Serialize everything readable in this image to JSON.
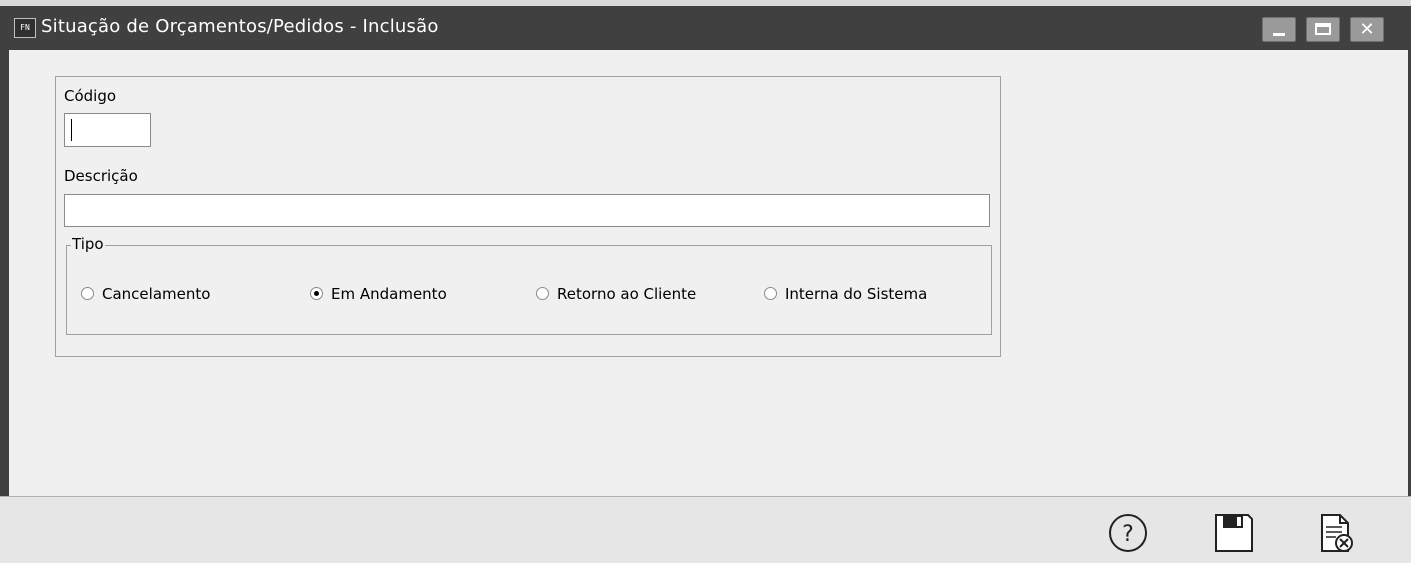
{
  "window": {
    "app_icon_text": "FN",
    "title": "Situação de Orçamentos/Pedidos - Inclusão",
    "controls": [
      "minimize",
      "maximize",
      "close"
    ],
    "close_glyph": "✕"
  },
  "form": {
    "codigo_label": "Código",
    "codigo_value": "",
    "descricao_label": "Descrição",
    "descricao_value": "",
    "tipo_label": "Tipo",
    "tipo_options": [
      {
        "label": "Cancelamento",
        "selected": false
      },
      {
        "label": "Em Andamento",
        "selected": true
      },
      {
        "label": "Retorno ao Cliente",
        "selected": false
      },
      {
        "label": "Interna do Sistema",
        "selected": false
      }
    ]
  },
  "toolbar": {
    "buttons": [
      "help-icon",
      "save-icon",
      "cancel-document-icon"
    ]
  },
  "colors": {
    "titlebar": "#404040",
    "content_bg": "#f0f0f0",
    "footer_bg": "#e6e6e6"
  }
}
